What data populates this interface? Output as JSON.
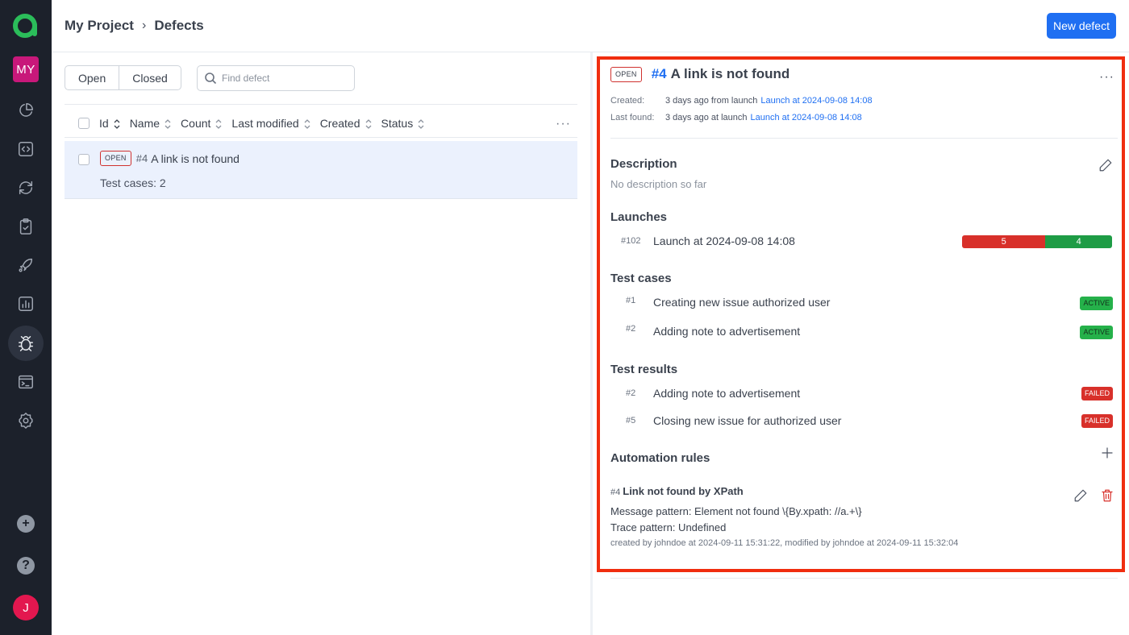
{
  "sidebar": {
    "project_badge": "MY",
    "user_initial": "J",
    "nav": [
      {
        "name": "dashboard",
        "icon": "pie-chart-icon"
      },
      {
        "name": "code",
        "icon": "code-icon"
      },
      {
        "name": "sync",
        "icon": "sync-icon"
      },
      {
        "name": "test-cases",
        "icon": "clipboard-check-icon"
      },
      {
        "name": "launches",
        "icon": "rocket-icon"
      },
      {
        "name": "analytics",
        "icon": "bar-chart-icon"
      },
      {
        "name": "defects",
        "icon": "bug-icon",
        "active": true
      },
      {
        "name": "jobs",
        "icon": "terminal-icon"
      },
      {
        "name": "settings",
        "icon": "gear-icon"
      }
    ],
    "add_label": "+",
    "help_label": "?"
  },
  "header": {
    "breadcrumb": [
      "My Project",
      "Defects"
    ],
    "new_button": "New defect"
  },
  "list": {
    "filters": [
      "Open",
      "Closed"
    ],
    "search_placeholder": "Find defect",
    "columns": [
      "Id",
      "Name",
      "Count",
      "Last modified",
      "Created",
      "Status"
    ],
    "more": "···",
    "rows": [
      {
        "badge": "OPEN",
        "id": "#4",
        "name": "A link is not found",
        "sub": "Test cases: 2"
      }
    ]
  },
  "detail": {
    "badge": "OPEN",
    "id": "#4",
    "title": "A link is not found",
    "more": "···",
    "created_label": "Created:",
    "created_text": "3 days ago from launch",
    "created_link": "Launch at 2024-09-08 14:08",
    "last_found_label": "Last found:",
    "last_found_text": "3 days ago at launch",
    "last_found_link": "Launch at 2024-09-08 14:08",
    "description_title": "Description",
    "description_text": "No description so far",
    "launches_title": "Launches",
    "launches": [
      {
        "id": "#102",
        "name": "Launch at 2024-09-08 14:08",
        "failed": 5,
        "passed": 4
      }
    ],
    "test_cases_title": "Test cases",
    "test_cases": [
      {
        "id": "#1",
        "name": "Creating new issue authorized user",
        "status": "ACTIVE"
      },
      {
        "id": "#2",
        "name": "Adding note to advertisement",
        "status": "ACTIVE"
      }
    ],
    "test_results_title": "Test results",
    "test_results": [
      {
        "id": "#2",
        "name": "Adding note to advertisement",
        "status": "FAILED"
      },
      {
        "id": "#5",
        "name": "Closing new issue for authorized user",
        "status": "FAILED"
      }
    ],
    "automation_title": "Automation rules",
    "rules": [
      {
        "id": "#4",
        "name": "Link not found by XPath",
        "message_pattern": "Message pattern: Element not found \\{By.xpath: //a.+\\}",
        "trace_pattern": "Trace pattern: Undefined",
        "meta": "created by johndoe at 2024-09-11 15:31:22, modified by johndoe at 2024-09-11 15:32:04"
      }
    ]
  },
  "colors": {
    "accent": "#1f6ff2",
    "failed": "#d8302a",
    "passed": "#1e9c45",
    "active_badge": "#25b14a",
    "highlight": "#f02d0f",
    "sidebar_bg": "#1c212b",
    "project_badge": "#c8187a",
    "user_avatar": "#e3174f"
  }
}
